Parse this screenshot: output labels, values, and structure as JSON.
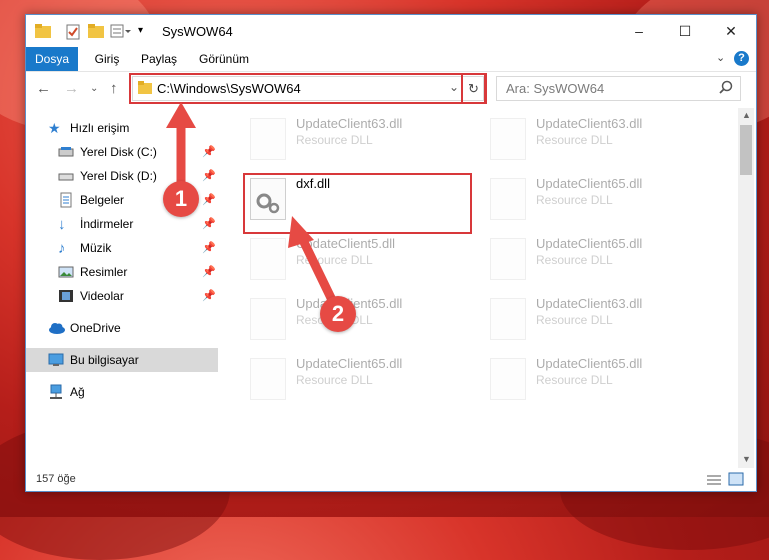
{
  "window": {
    "title": "SysWOW64",
    "controls": {
      "minimize": "–",
      "maximize": "☐",
      "close": "✕"
    },
    "help": "?"
  },
  "ribbon": {
    "tabs": [
      {
        "label": "Dosya",
        "active": true
      },
      {
        "label": "Giriş"
      },
      {
        "label": "Paylaş"
      },
      {
        "label": "Görünüm"
      }
    ]
  },
  "nav": {
    "address": "C:\\Windows\\SysWOW64",
    "search_placeholder": "Ara: SysWOW64"
  },
  "sidebar": {
    "items": [
      {
        "label": "Hızlı erişim",
        "icon": "star-icon"
      },
      {
        "label": "Yerel Disk (C:)",
        "icon": "drive-icon",
        "pinned": true
      },
      {
        "label": "Yerel Disk (D:)",
        "icon": "drive-icon",
        "pinned": true
      },
      {
        "label": "Belgeler",
        "icon": "documents-icon",
        "pinned": true
      },
      {
        "label": "İndirmeler",
        "icon": "downloads-icon",
        "pinned": true
      },
      {
        "label": "Müzik",
        "icon": "music-icon",
        "pinned": true
      },
      {
        "label": "Resimler",
        "icon": "pictures-icon",
        "pinned": true
      },
      {
        "label": "Videolar",
        "icon": "videos-icon",
        "pinned": true
      },
      {
        "label": "OneDrive",
        "icon": "cloud-icon"
      },
      {
        "label": "Bu bilgisayar",
        "icon": "computer-icon",
        "selected": true
      },
      {
        "label": "Ağ",
        "icon": "network-icon"
      }
    ]
  },
  "files": [
    {
      "name": "UpdateClient63.dll",
      "type": "Resource DLL",
      "faded": true
    },
    {
      "name": "UpdateClient63.dll",
      "type": "Resource DLL",
      "faded": true
    },
    {
      "name": "dxf.dll",
      "type": "",
      "faded": false
    },
    {
      "name": "UpdateClient65.dll",
      "type": "Resource DLL",
      "faded": true
    },
    {
      "name": "UpdateClient5.dll",
      "type": "Resource DLL",
      "faded": true
    },
    {
      "name": "UpdateClient65.dll",
      "type": "Resource DLL",
      "faded": true
    },
    {
      "name": "UpdateClient65.dll",
      "type": "Resource DLL",
      "faded": true
    },
    {
      "name": "UpdateClient63.dll",
      "type": "Resource DLL",
      "faded": true
    },
    {
      "name": "UpdateClient65.dll",
      "type": "Resource DLL",
      "faded": true
    },
    {
      "name": "UpdateClient65.dll",
      "type": "Resource DLL",
      "faded": true
    }
  ],
  "status": {
    "count": "157 öğe"
  },
  "annotations": {
    "step1": "1",
    "step2": "2"
  },
  "colors": {
    "accent": "#1979ca",
    "highlight": "#d8383a",
    "badge": "#e64a44"
  }
}
